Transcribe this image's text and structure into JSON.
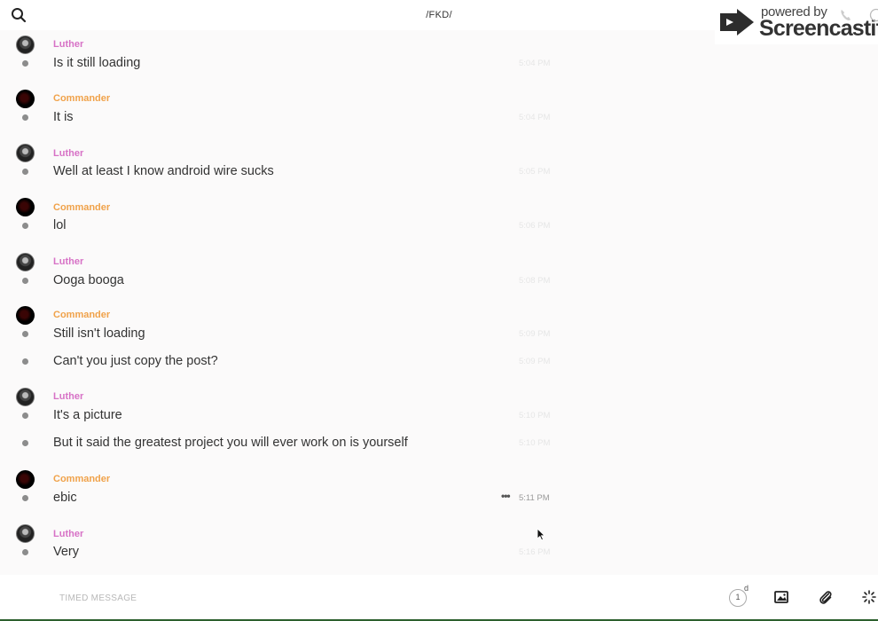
{
  "header": {
    "channel_title": "/FKD/"
  },
  "watermark": {
    "powered_text": "powered by",
    "brand_text": "Screencastify"
  },
  "colors": {
    "luther_name": "#d772c6",
    "commander_name": "#f0a24a"
  },
  "messages": [
    {
      "sender": "Luther",
      "text": "Is it still loading",
      "time": "5:04 PM"
    },
    {
      "sender": "Commander",
      "text": "It is",
      "time": "5:04 PM"
    },
    {
      "sender": "Luther",
      "text": "Well at least I know android wire sucks",
      "time": "5:05 PM"
    },
    {
      "sender": "Commander",
      "text": "lol",
      "time": "5:06 PM"
    },
    {
      "sender": "Luther",
      "text": "Ooga booga",
      "time": "5:08 PM"
    },
    {
      "sender": "Commander",
      "text": "Still isn't loading",
      "time": "5:09 PM"
    },
    {
      "sender": "",
      "text": "Can't you just copy the post?",
      "time": "5:09 PM"
    },
    {
      "sender": "Luther",
      "text": "It's a picture",
      "time": "5:10 PM"
    },
    {
      "sender": "",
      "text": "But it said the greatest project you will ever work on is yourself",
      "time": "5:10 PM"
    },
    {
      "sender": "Commander",
      "text": "ebic",
      "time": "5:11 PM",
      "hovered": true
    },
    {
      "sender": "Luther",
      "text": "Very",
      "time": "5:16 PM"
    }
  ],
  "composer": {
    "placeholder": "TIMED MESSAGE",
    "timer_value": "1",
    "timer_unit": "d"
  },
  "icons": {
    "search": "search-icon",
    "more": "more-options-icon",
    "timer": "timer-icon",
    "image": "image-icon",
    "attach": "paperclip-icon",
    "send": "send-spinner-icon"
  }
}
